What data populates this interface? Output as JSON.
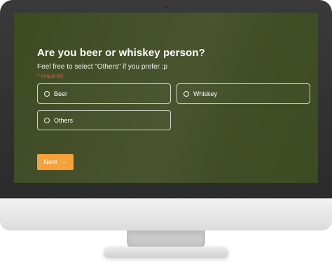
{
  "question": "Are you beer or whiskey person?",
  "description": "Feel free to select \"Others\" if you prefer :p",
  "required_label": "* required",
  "options": [
    {
      "label": "Beer"
    },
    {
      "label": "Whiskey"
    },
    {
      "label": "Others"
    }
  ],
  "next_button": {
    "label": "Next",
    "arrow": "→"
  },
  "colors": {
    "screen_bg": "#3e4a22",
    "button_bg": "#f6a23a",
    "required_text": "#e35a4b"
  },
  "icons": {
    "radio": "radio-unchecked-icon",
    "next": "arrow-right-icon"
  }
}
